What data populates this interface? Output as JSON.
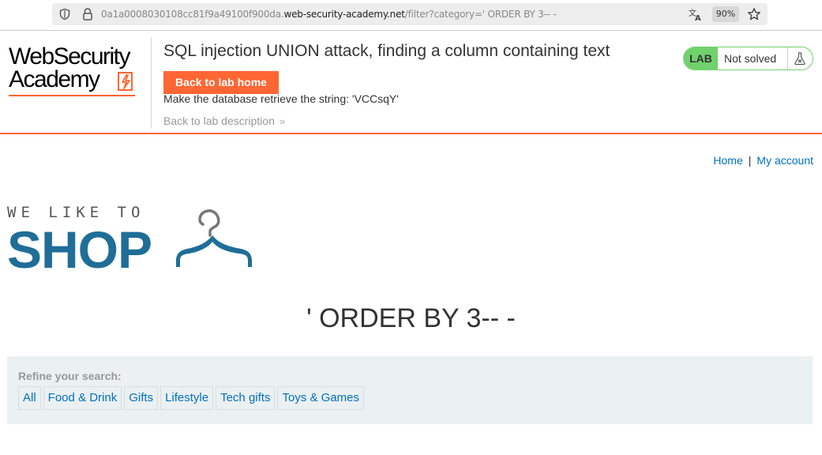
{
  "browser": {
    "url_prefix": "0a1a0008030108cc81f9a49100f900da.",
    "url_host": "web-security-academy.net",
    "url_path": "/filter?category=' ORDER BY 3-- -",
    "zoom": "90%",
    "icons": [
      "shield-icon",
      "lock-icon",
      "translate-icon",
      "star-icon"
    ]
  },
  "academy": {
    "logo_line1": "WebSecurity",
    "logo_line2": "Academy",
    "lab_title": "SQL injection UNION attack, finding a column containing text",
    "back_home_label": "Back to lab home",
    "instruction": "Make the database retrieve the string: 'VCCsqY'",
    "back_description_label": "Back to lab description",
    "status_badge": "LAB",
    "status_text": "Not solved",
    "accent_color": "#ff6633",
    "status_color": "#70d16d"
  },
  "nav": {
    "home_label": "Home",
    "separator": "|",
    "account_label": "My account"
  },
  "shop_logo": {
    "tagline": "WE LIKE TO",
    "word": "SHOP"
  },
  "heading": "' ORDER BY 3-- -",
  "filter": {
    "label": "Refine your search:",
    "categories": [
      "All",
      "Food & Drink",
      "Gifts",
      "Lifestyle",
      "Tech gifts",
      "Toys & Games"
    ]
  }
}
